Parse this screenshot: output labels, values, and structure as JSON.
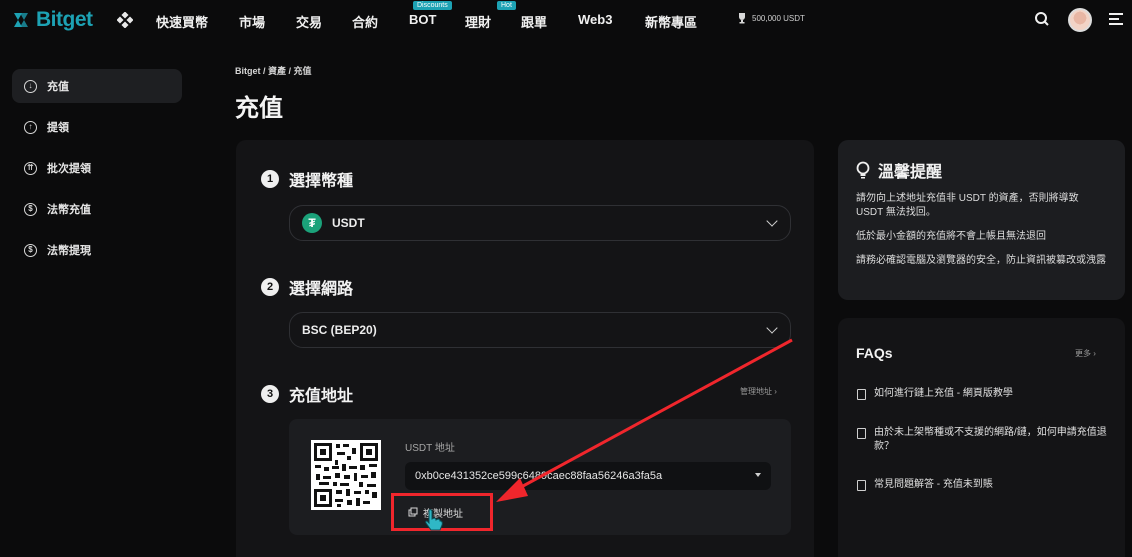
{
  "brand": {
    "name": "Bitget",
    "accent": "#1da2b4"
  },
  "nav": {
    "items": [
      "快速買幣",
      "市場",
      "交易",
      "合約",
      "BOT",
      "理財",
      "跟單",
      "Web3",
      "新幣專區"
    ],
    "bot_badge": "Discounts",
    "earn_badge": "Hot",
    "promo": "500,000 USDT"
  },
  "sidebar": {
    "items": [
      {
        "label": "充值",
        "icon": "arrow-down-circle-icon"
      },
      {
        "label": "提領",
        "icon": "arrow-up-circle-icon"
      },
      {
        "label": "批次提領",
        "icon": "batch-circle-icon"
      },
      {
        "label": "法幣充值",
        "icon": "fiat-deposit-icon"
      },
      {
        "label": "法幣提現",
        "icon": "fiat-withdraw-icon"
      }
    ]
  },
  "breadcrumb": "Bitget / 資產 / 充值",
  "page_title": "充值",
  "steps": {
    "coin": {
      "num": "1",
      "title": "選擇幣種",
      "value": "USDT"
    },
    "network": {
      "num": "2",
      "title": "選擇網路",
      "value": "BSC (BEP20)"
    },
    "address": {
      "num": "3",
      "title": "充值地址",
      "manage": "管理地址"
    }
  },
  "deposit": {
    "address_label": "USDT 地址",
    "address": "0xb0ce431352ce599c6489caec88faa56246a3fa5a",
    "copy_label": "複製地址"
  },
  "tips": {
    "title": "溫馨提醒",
    "lines": [
      "請勿向上述地址充值非 USDT 的資產，否則將導致 USDT 無法找回。",
      "低於最小金額的充值將不會上帳且無法退回",
      "請務必確認電腦及瀏覽器的安全，防止資訊被篡改或洩露"
    ]
  },
  "faqs": {
    "title": "FAQs",
    "more": "更多",
    "items": [
      "如何進行鏈上充值 - 網頁版教學",
      "由於未上架幣種或不支援的網路/鏈，如何申請充值退款？",
      "常見問題解答 - 充值未到賬"
    ]
  },
  "colors": {
    "highlight": "#f0262c",
    "tether": "#1ba27a"
  }
}
